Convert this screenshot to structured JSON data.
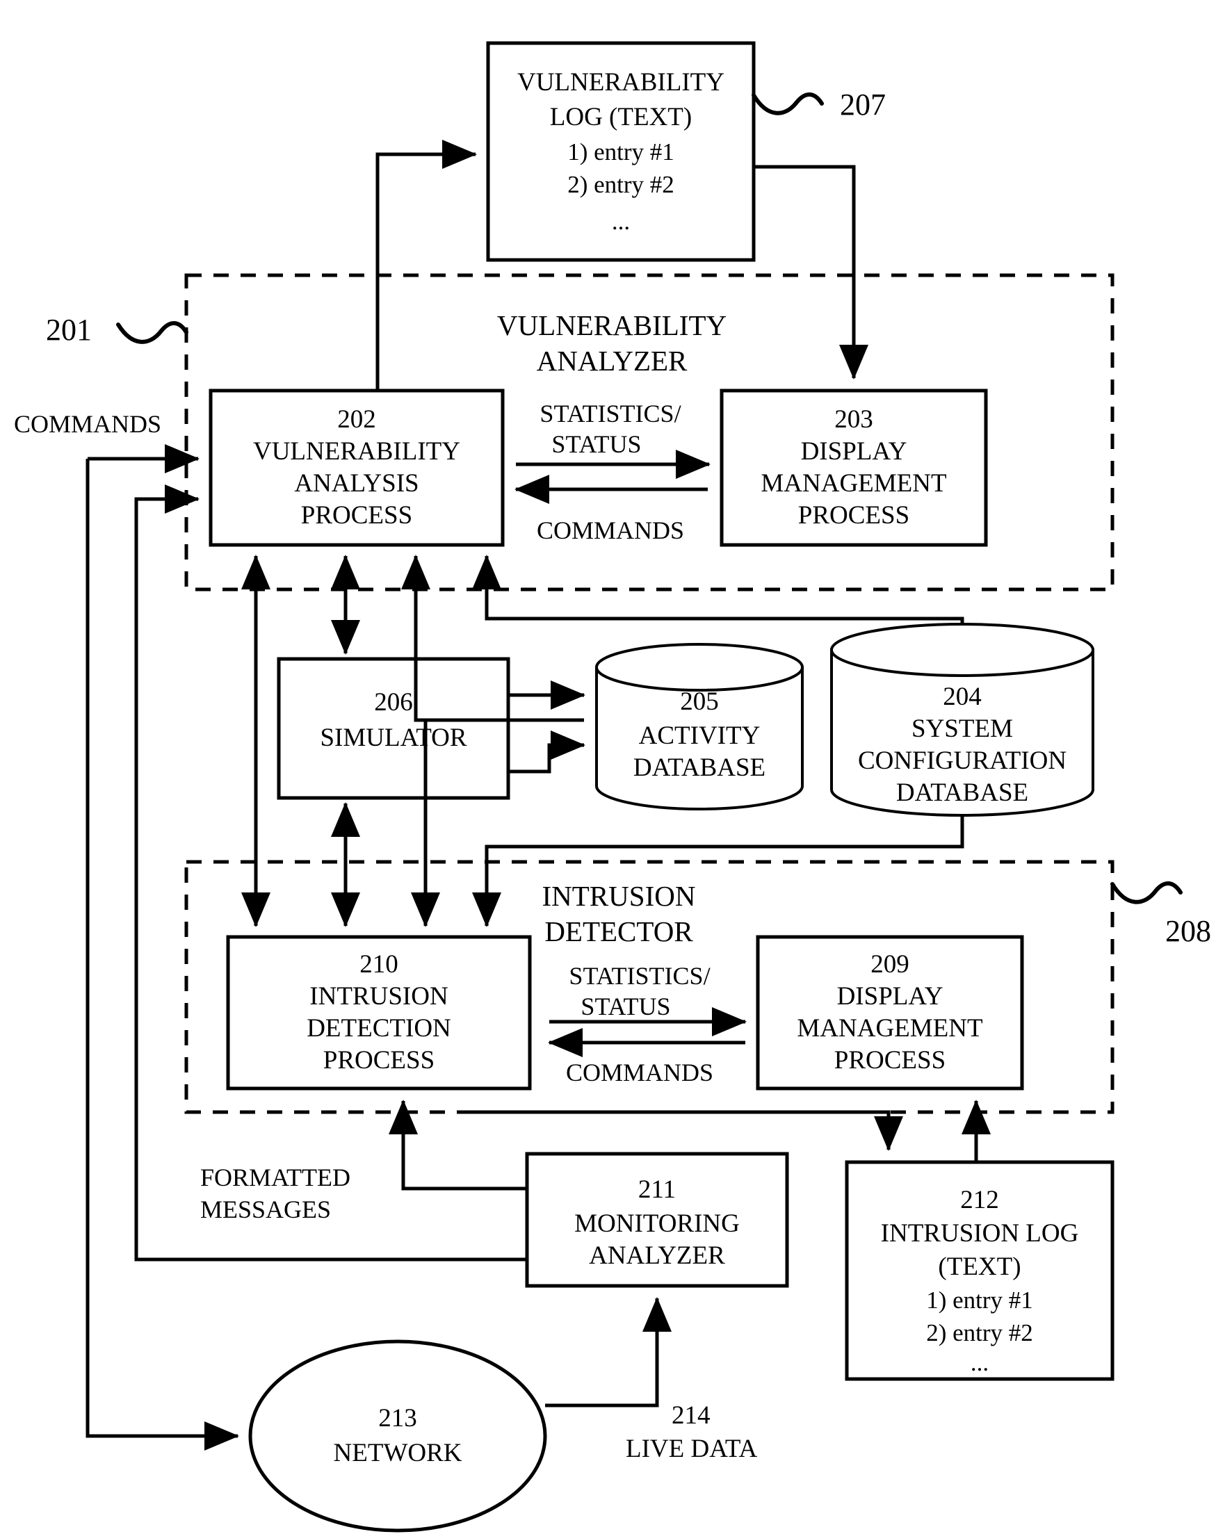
{
  "figure": {
    "title": "Vulnerability Analyzer and Intrusion Detector block diagram"
  },
  "nodes": {
    "vuln_log": {
      "ref": "207",
      "line1": "VULNERABILITY",
      "line2": "LOG (TEXT)",
      "entry1": "1) entry #1",
      "entry2": "2) entry #2",
      "ellipsis": "..."
    },
    "vuln_analyzer_group": {
      "ref": "201",
      "line1": "VULNERABILITY",
      "line2": "ANALYZER"
    },
    "vuln_analysis_process": {
      "ref": "202",
      "line1": "VULNERABILITY",
      "line2": "ANALYSIS",
      "line3": "PROCESS"
    },
    "display_mgmt_top": {
      "ref": "203",
      "line1": "DISPLAY",
      "line2": "MANAGEMENT",
      "line3": "PROCESS"
    },
    "sys_config_db": {
      "ref": "204",
      "line1": "SYSTEM",
      "line2": "CONFIGURATION",
      "line3": "DATABASE"
    },
    "activity_db": {
      "ref": "205",
      "line1": "ACTIVITY",
      "line2": "DATABASE"
    },
    "simulator": {
      "ref": "206",
      "line1": "SIMULATOR"
    },
    "intrusion_detector_group": {
      "ref": "208",
      "line1": "INTRUSION",
      "line2": "DETECTOR"
    },
    "display_mgmt_bottom": {
      "ref": "209",
      "line1": "DISPLAY",
      "line2": "MANAGEMENT",
      "line3": "PROCESS"
    },
    "intrusion_detection_process": {
      "ref": "210",
      "line1": "INTRUSION",
      "line2": "DETECTION",
      "line3": "PROCESS"
    },
    "monitoring_analyzer": {
      "ref": "211",
      "line1": "MONITORING",
      "line2": "ANALYZER"
    },
    "intrusion_log": {
      "ref": "212",
      "line1": "INTRUSION LOG",
      "line2": "(TEXT)",
      "entry1": "1) entry #1",
      "entry2": "2) entry #2",
      "ellipsis": "..."
    },
    "network": {
      "ref": "213",
      "line1": "NETWORK"
    },
    "live_data": {
      "ref": "214",
      "line1": "LIVE DATA"
    }
  },
  "edge_labels": {
    "commands_left": "COMMANDS",
    "stats_status_top_1": "STATISTICS/",
    "stats_status_top_2": "STATUS",
    "commands_top": "COMMANDS",
    "stats_status_bottom_1": "STATISTICS/",
    "stats_status_bottom_2": "STATUS",
    "commands_bottom": "COMMANDS",
    "formatted_messages_1": "FORMATTED",
    "formatted_messages_2": "MESSAGES"
  },
  "colors": {
    "ink": "#000000",
    "paper": "#ffffff"
  }
}
